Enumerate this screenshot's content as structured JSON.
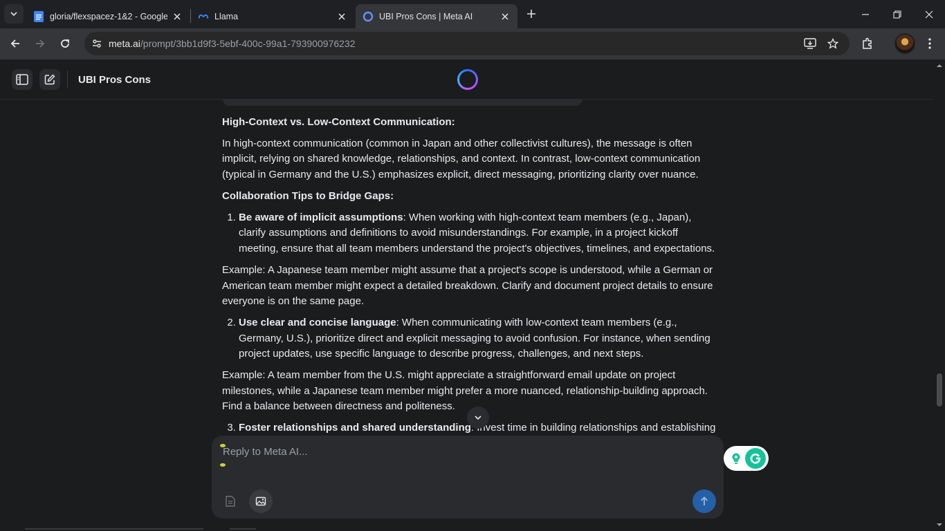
{
  "browser": {
    "tabs": [
      {
        "title": "gloria/flexspacez-1&2 - Google",
        "favicon": "google-docs-icon"
      },
      {
        "title": "Llama",
        "favicon": "meta-icon"
      },
      {
        "title": "UBI Pros Cons | Meta AI",
        "favicon": "meta-ai-icon",
        "active": true
      }
    ],
    "url_host": "meta.ai",
    "url_path": "/prompt/3bb1d9f3-5ebf-400c-99a1-793900976232"
  },
  "header": {
    "chat_title": "UBI Pros Cons"
  },
  "content": {
    "h1": "High-Context vs. Low-Context Communication:",
    "p1": "In high-context communication (common in Japan and other collectivist cultures), the message is often implicit, relying on shared knowledge, relationships, and context. In contrast, low-context communication (typical in Germany and the U.S.) emphasizes explicit, direct messaging, prioritizing clarity over nuance.",
    "h2": "Collaboration Tips to Bridge Gaps:",
    "tip1_bold": "Be aware of implicit assumptions",
    "tip1_text": ": When working with high-context team members (e.g., Japan), clarify assumptions and definitions to avoid misunderstandings. For example, in a project kickoff meeting, ensure that all team members understand the project's objectives, timelines, and expectations.",
    "ex1": "Example: A Japanese team member might assume that a project's scope is understood, while a German or American team member might expect a detailed breakdown. Clarify and document project details to ensure everyone is on the same page.",
    "tip2_bold": "Use clear and concise language",
    "tip2_text": ": When communicating with low-context team members (e.g., Germany, U.S.), prioritize direct and explicit messaging to avoid confusion. For instance, when sending project updates, use specific language to describe progress, challenges, and next steps.",
    "ex2": "Example: A team member from the U.S. might appreciate a straightforward email update on project milestones, while a Japanese team member might prefer a more nuanced, relationship-building approach. Find a balance between directness and politeness.",
    "tip3_bold": "Foster relationships and shared understanding",
    "tip3_text": ": Invest time in building relationships and establishing a"
  },
  "composer": {
    "placeholder": "Reply to Meta AI..."
  },
  "colors": {
    "page_bg": "#1b1c1e",
    "composer_bg": "#2a2b2e",
    "send_button": "#2460a8",
    "grammarly": "#15c39a"
  }
}
